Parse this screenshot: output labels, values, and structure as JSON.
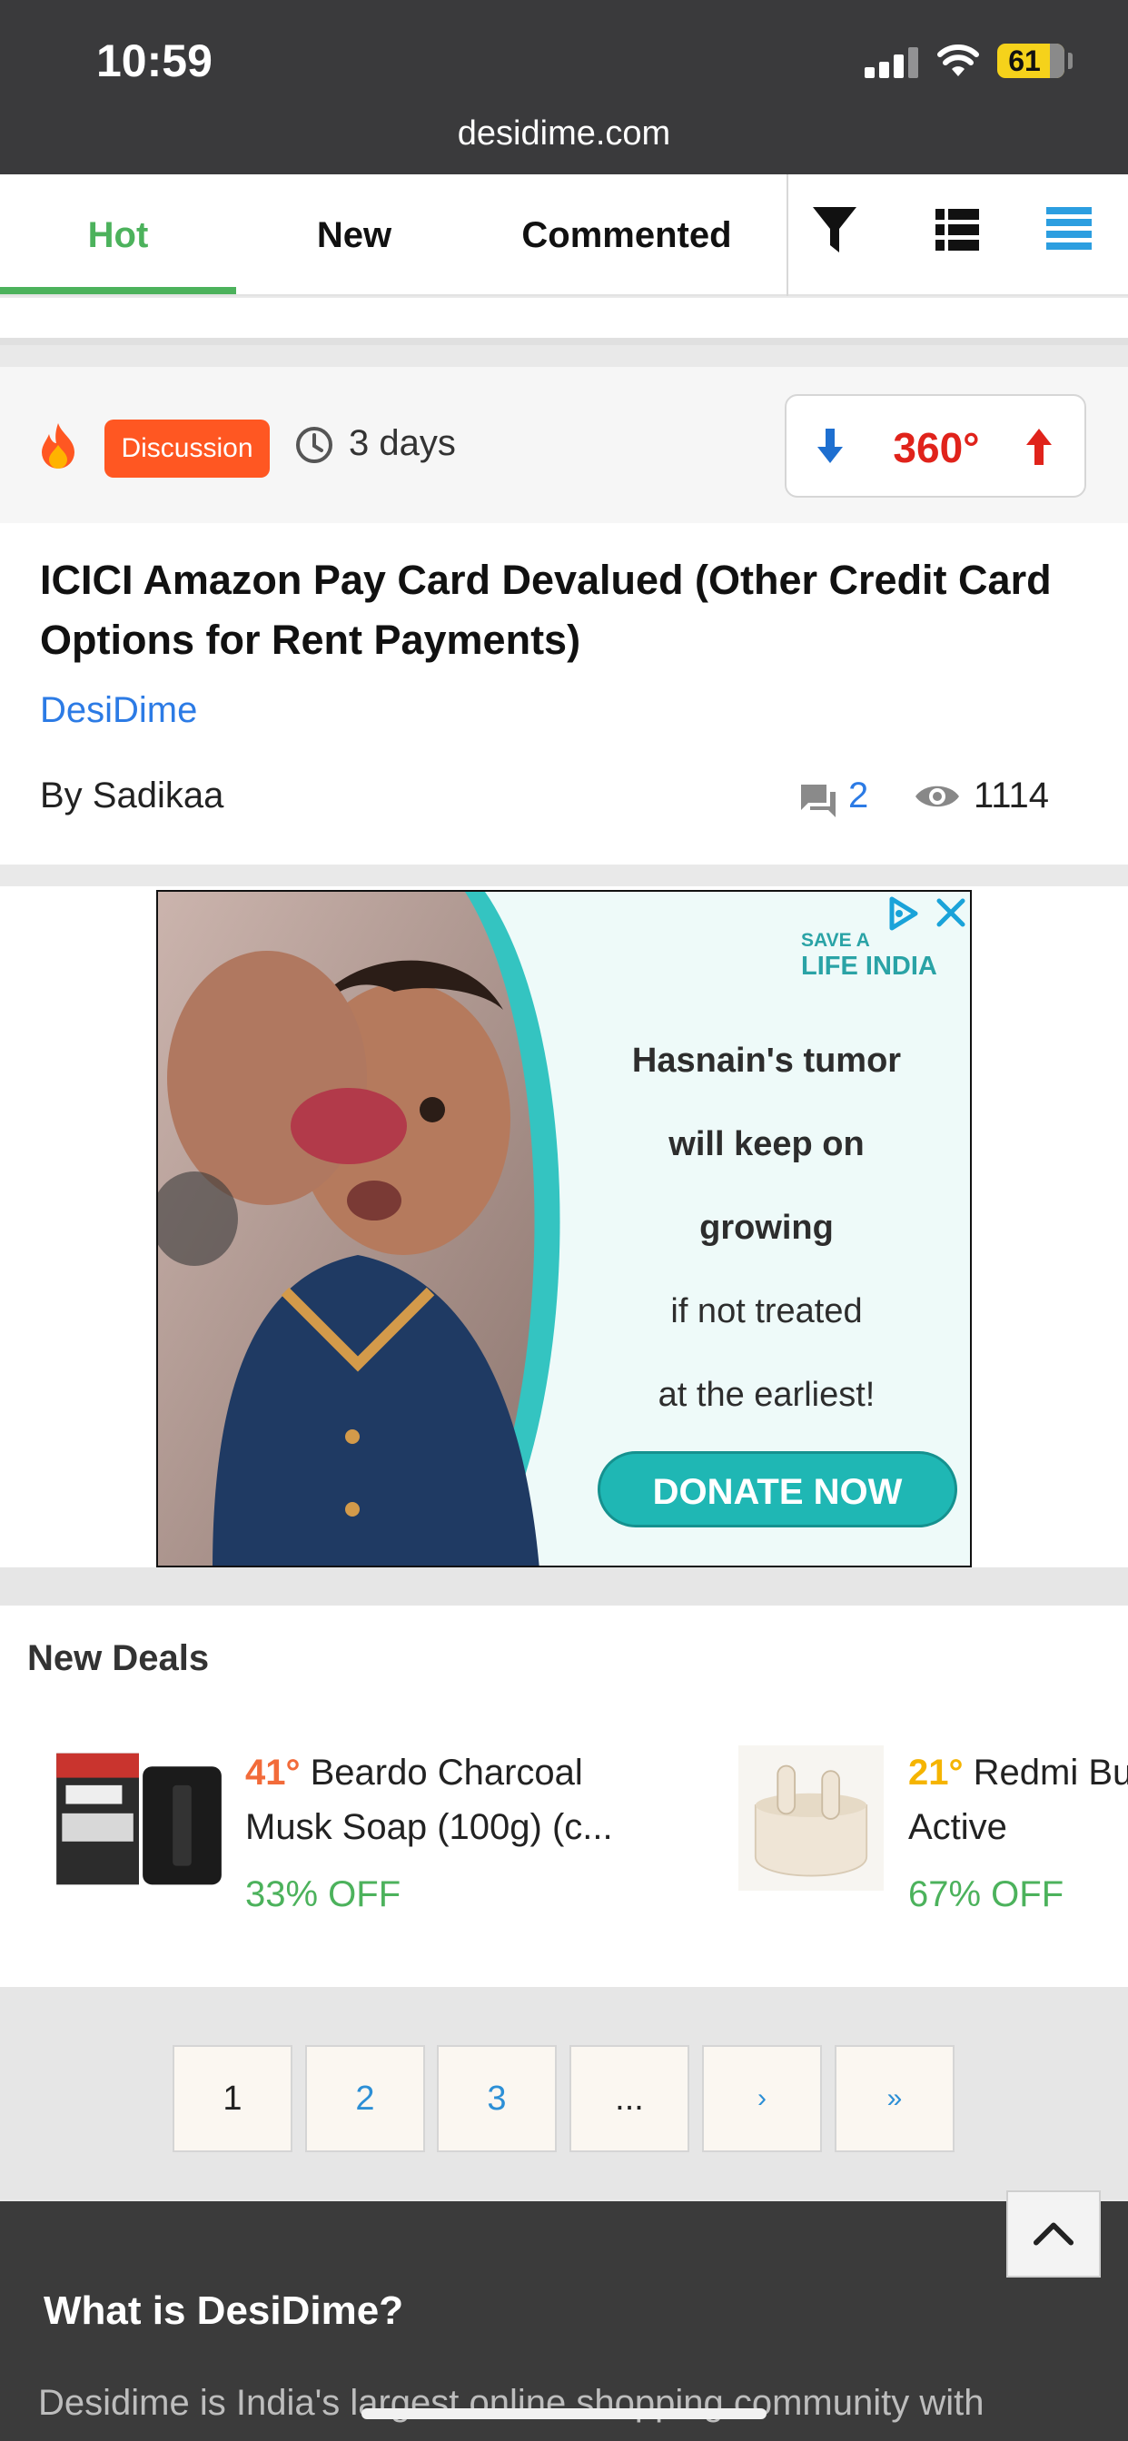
{
  "status_bar": {
    "time": "10:59",
    "battery": "61"
  },
  "browser": {
    "url": "desidime.com"
  },
  "nav": {
    "tabs": [
      "Hot",
      "New",
      "Commented"
    ]
  },
  "post": {
    "badge": "Discussion",
    "age": "3 days",
    "temperature": "360°",
    "title": "ICICI Amazon Pay Card Devalued (Other Credit Card Options for Rent Payments)",
    "store": "DesiDime",
    "author": "By Sadikaa",
    "comments": "2",
    "views": "1114"
  },
  "ad": {
    "org_line1": "SAVE A",
    "org_line2": "LIFE INDIA",
    "line1": "Hasnain's tumor",
    "line2": "will keep on",
    "line3": "growing",
    "line4": "if not treated",
    "line5": "at the earliest!",
    "cta": "DONATE NOW"
  },
  "new_deals": {
    "title": "New Deals",
    "items": [
      {
        "temp": "41°",
        "name_line1": "Beardo Charcoal",
        "name_line2": "Musk Soap (100g) (c...",
        "discount": "33% OFF",
        "temp_color": "#f26b3a"
      },
      {
        "temp": "21°",
        "name_line1": "Redmi Bu",
        "name_line2": "Active",
        "discount": "67% OFF",
        "temp_color": "#f5b400"
      }
    ]
  },
  "pagination": [
    "1",
    "2",
    "3",
    "...",
    "›",
    "»"
  ],
  "footer": {
    "title": "What is DesiDime?",
    "text": "Desidime is India's largest online shopping community with"
  },
  "colors": {
    "accent_green": "#4cb25c",
    "badge_orange": "#ff5722",
    "temp_red": "#e0231b",
    "link_blue": "#2c7be5"
  }
}
